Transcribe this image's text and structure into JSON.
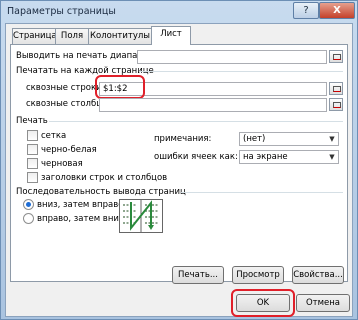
{
  "window": {
    "title": "Параметры страницы",
    "help_label": "?",
    "close_label": "X"
  },
  "tabs": [
    {
      "label": "Страница"
    },
    {
      "label": "Поля"
    },
    {
      "label": "Колонтитулы"
    },
    {
      "label": "Лист",
      "active": true
    }
  ],
  "print_area": {
    "label": "Выводить на печать диапазон:",
    "value": ""
  },
  "print_titles": {
    "group_label": "Печатать на каждой странице",
    "rows_label": "сквозные строки:",
    "rows_value": "$1:$2",
    "cols_label": "сквозные столбцы:",
    "cols_value": ""
  },
  "print": {
    "group_label": "Печать",
    "options": [
      {
        "label": "сетка",
        "checked": false
      },
      {
        "label": "черно-белая",
        "checked": false
      },
      {
        "label": "черновая",
        "checked": false
      },
      {
        "label": "заголовки строк и столбцов",
        "checked": false
      }
    ],
    "comments_label": "примечания:",
    "comments_value": "(нет)",
    "errors_label": "ошибки ячеек как:",
    "errors_value": "на экране"
  },
  "page_order": {
    "group_label": "Последовательность вывода страниц",
    "options": [
      {
        "label": "вниз, затем вправо",
        "selected": true
      },
      {
        "label": "вправо, затем вниз",
        "selected": false
      }
    ]
  },
  "buttons": {
    "print": "Печать...",
    "preview": "Просмотр",
    "properties": "Свойства...",
    "ok": "OK",
    "cancel": "Отмена"
  },
  "accent": {
    "highlight": "#e0202a",
    "radio": "#1f6ed6",
    "arrow": "#2a8a3c"
  }
}
